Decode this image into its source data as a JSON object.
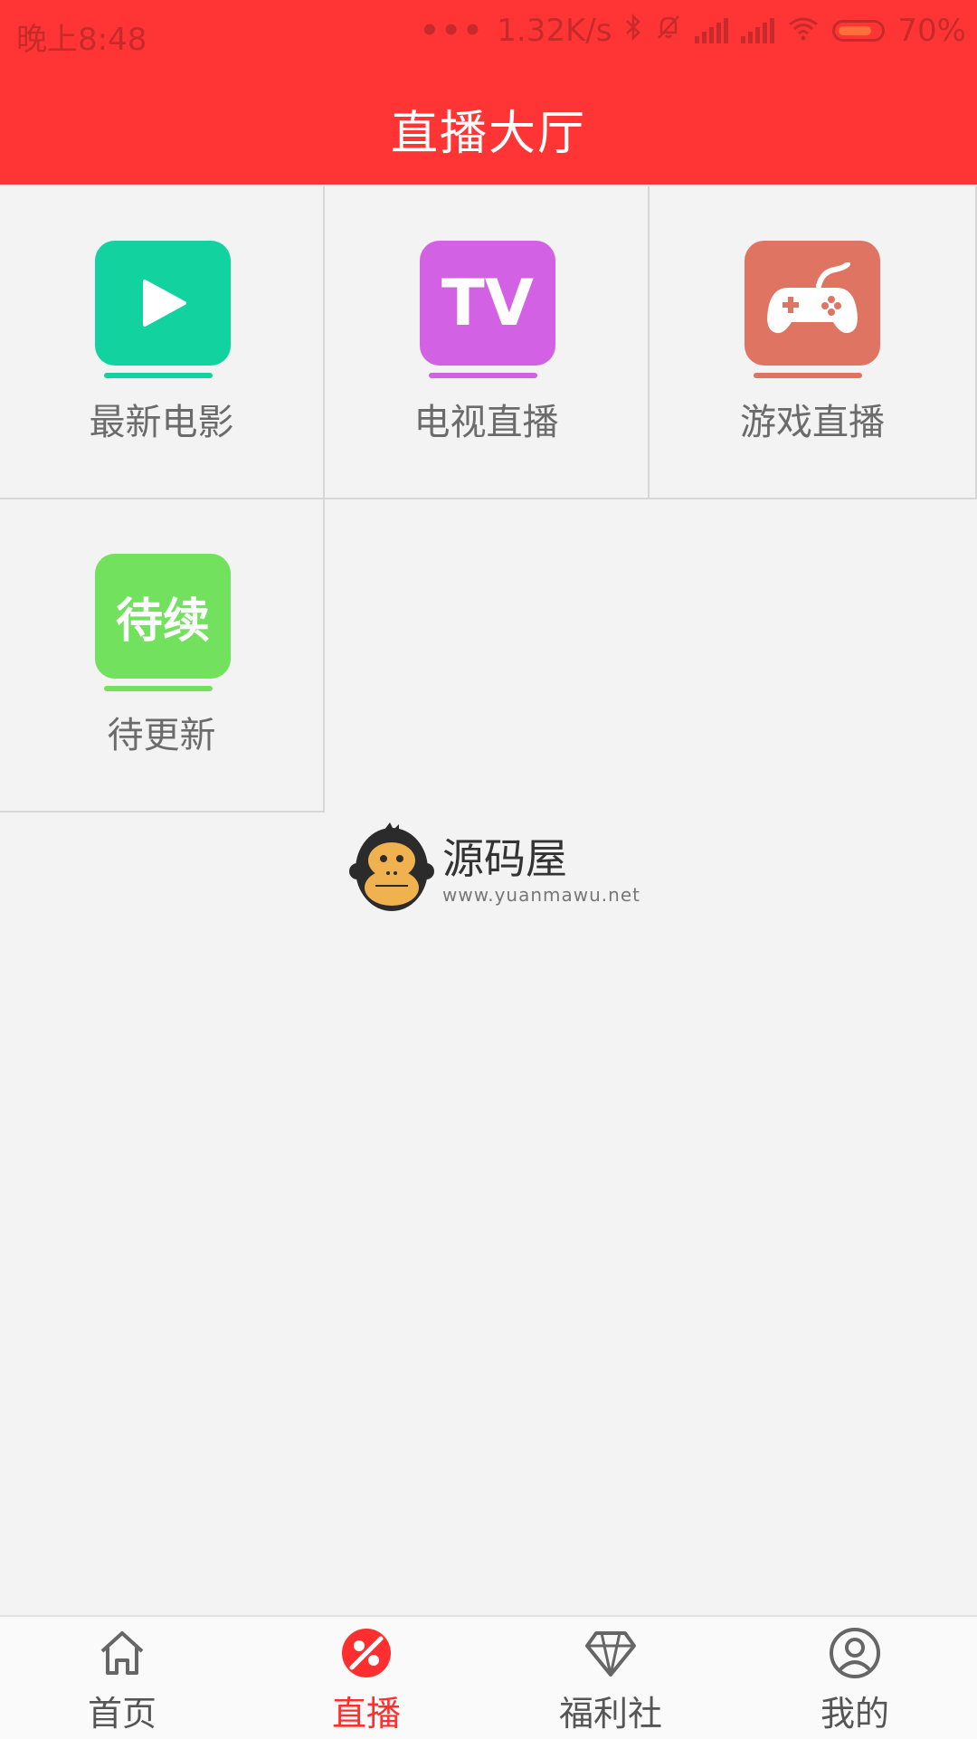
{
  "status_bar": {
    "time": "晚上8:48",
    "dots": "•••",
    "speed": "1.32K/s",
    "battery": "70%"
  },
  "header": {
    "title": "直播大厅"
  },
  "categories": [
    {
      "label": "最新电影",
      "icon": "play-icon",
      "color": "#12d39f"
    },
    {
      "label": "电视直播",
      "icon": "tv-icon",
      "icon_text": "TV",
      "color": "#d262e3"
    },
    {
      "label": "游戏直播",
      "icon": "gamepad-icon",
      "color": "#e07463"
    },
    {
      "label": "待更新",
      "icon": "coming-soon-icon",
      "icon_text": "待续",
      "color": "#72e15e"
    }
  ],
  "watermark": {
    "name": "源码屋",
    "url": "www.yuanmawu.net"
  },
  "bottom_nav": {
    "items": [
      {
        "label": "首页",
        "icon": "home-icon"
      },
      {
        "label": "直播",
        "icon": "live-icon",
        "active": true
      },
      {
        "label": "福利社",
        "icon": "diamond-icon"
      },
      {
        "label": "我的",
        "icon": "user-icon"
      }
    ],
    "active_color": "#ff2f2f"
  }
}
